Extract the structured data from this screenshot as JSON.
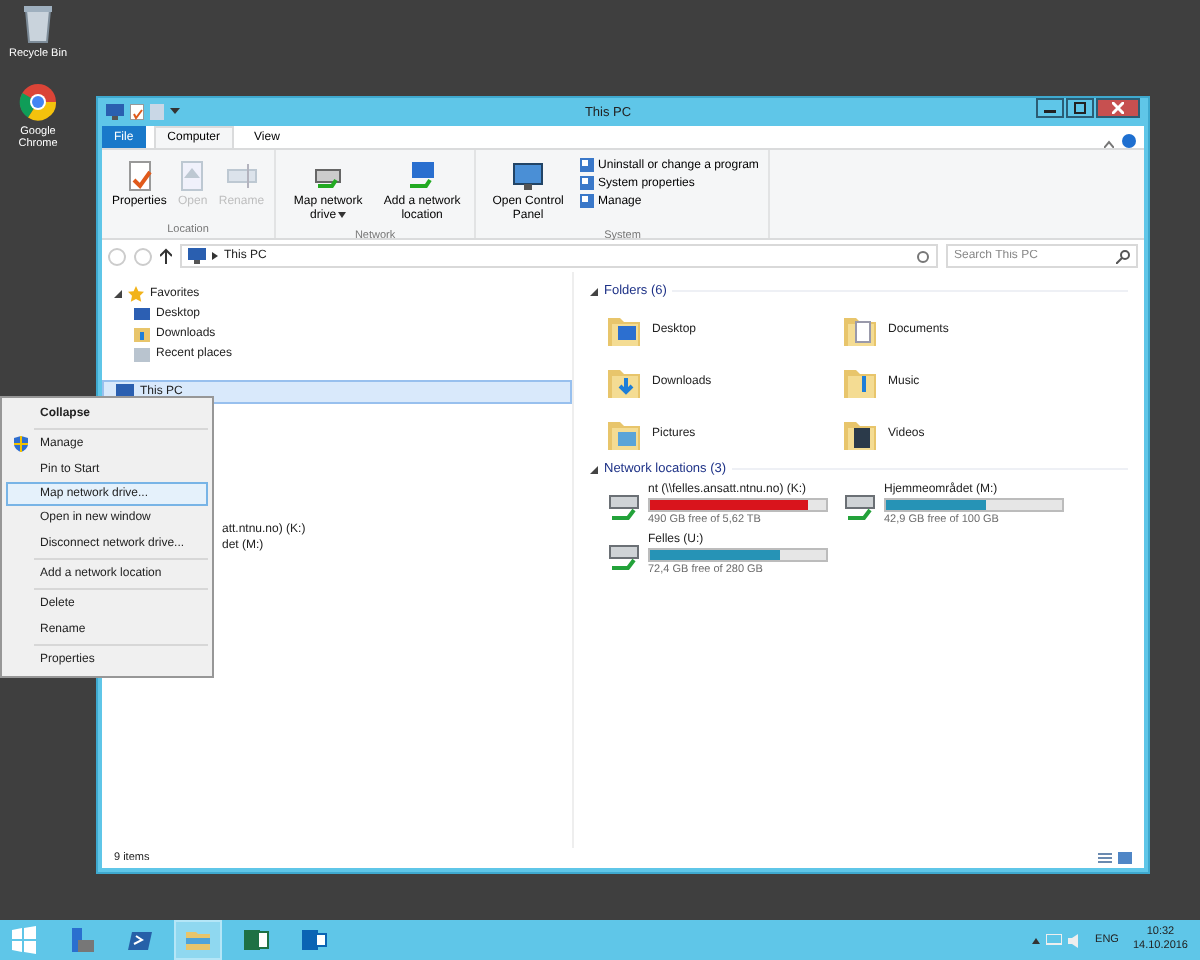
{
  "desktop_icons": [
    {
      "label": "Recycle Bin",
      "kind": "bin"
    },
    {
      "label": "Google Chrome",
      "kind": "browser"
    }
  ],
  "window": {
    "title": "This PC"
  },
  "ribbon_tabs": [
    {
      "label": "File",
      "kind": "file",
      "selected": false
    },
    {
      "label": "Computer",
      "kind": "tab",
      "selected": true
    },
    {
      "label": "View",
      "kind": "tab",
      "selected": false
    }
  ],
  "ribbon_groups": [
    {
      "label": "Location",
      "buttons": [
        {
          "label": "Properties",
          "kind": "props",
          "disabled": false
        },
        {
          "label": "Open",
          "kind": "open",
          "disabled": true
        },
        {
          "label": "Rename",
          "kind": "rename",
          "disabled": true
        }
      ]
    },
    {
      "label": "Network",
      "buttons": [
        {
          "label": "Map network drive",
          "kind": "mapdrive",
          "disabled": false,
          "dropdown": true
        },
        {
          "label": "Add a network location",
          "kind": "netloc",
          "disabled": false
        }
      ]
    },
    {
      "label": "System",
      "buttons": [
        {
          "label": "Open Control Panel",
          "kind": "panel",
          "disabled": false
        }
      ],
      "small_buttons": [
        {
          "label": "Uninstall or change a program"
        },
        {
          "label": "System properties"
        },
        {
          "label": "Manage"
        }
      ]
    }
  ],
  "address": {
    "path": "This PC",
    "search_placeholder": "Search This PC"
  },
  "nav": {
    "favorites": {
      "label": "Favorites",
      "expanded": true,
      "children": [
        {
          "label": "Desktop",
          "kind": "desktop"
        },
        {
          "label": "Downloads",
          "kind": "downloads"
        },
        {
          "label": "Recent places",
          "kind": "recent"
        }
      ]
    },
    "this_pc": {
      "label": "This PC",
      "selected": true
    },
    "partial_items": [
      "att.ntnu.no) (K:)",
      "det (M:)"
    ]
  },
  "folders": {
    "title": "Folders (6)",
    "items": [
      {
        "label": "Desktop",
        "kind": "desktop"
      },
      {
        "label": "Documents",
        "kind": "documents"
      },
      {
        "label": "Downloads",
        "kind": "downloads"
      },
      {
        "label": "Music",
        "kind": "music"
      },
      {
        "label": "Pictures",
        "kind": "pictures"
      },
      {
        "label": "Videos",
        "kind": "videos"
      }
    ]
  },
  "network": {
    "title": "Network locations (3)",
    "items": [
      {
        "label": "nt (\\\\felles.ansatt.ntnu.no) (K:)",
        "level": 0.9,
        "color": "#d9141c",
        "free": "490 GB free of 5,62 TB"
      },
      {
        "label": "Hjemmeområdet (M:)",
        "level": 0.57,
        "color": "#2693b6",
        "free": "42,9 GB free of 100 GB"
      },
      {
        "label": "Felles (U:)",
        "level": 0.74,
        "color": "#2693b6",
        "free": "72,4 GB free of 280 GB"
      }
    ]
  },
  "status_bar": {
    "items": "9 items"
  },
  "context_menu": [
    {
      "label": "Collapse",
      "kind": "default",
      "selected": false
    },
    {
      "kind": "separator"
    },
    {
      "label": "Manage",
      "kind": "shield",
      "selected": false
    },
    {
      "label": "Pin to Start",
      "kind": "item",
      "selected": false
    },
    {
      "label": "Map network drive...",
      "kind": "item",
      "selected": true
    },
    {
      "label": "Open in new window",
      "kind": "item",
      "selected": false
    },
    {
      "label": "Disconnect network drive...",
      "kind": "item",
      "selected": false
    },
    {
      "kind": "separator"
    },
    {
      "label": "Add a network location",
      "kind": "item",
      "selected": false
    },
    {
      "kind": "separator"
    },
    {
      "label": "Delete",
      "kind": "item",
      "selected": false
    },
    {
      "label": "Rename",
      "kind": "item",
      "selected": false
    },
    {
      "kind": "separator"
    },
    {
      "label": "Properties",
      "kind": "item",
      "selected": false
    }
  ],
  "taskbar": {
    "apps": [
      {
        "kind": "start",
        "active": false
      },
      {
        "kind": "server",
        "active": false
      },
      {
        "kind": "shell",
        "active": false
      },
      {
        "kind": "explorer",
        "active": true
      },
      {
        "kind": "excel",
        "active": false
      },
      {
        "kind": "outlook",
        "active": false
      }
    ],
    "language": "ENG",
    "time": "10:32",
    "date": "14.10.2016"
  }
}
